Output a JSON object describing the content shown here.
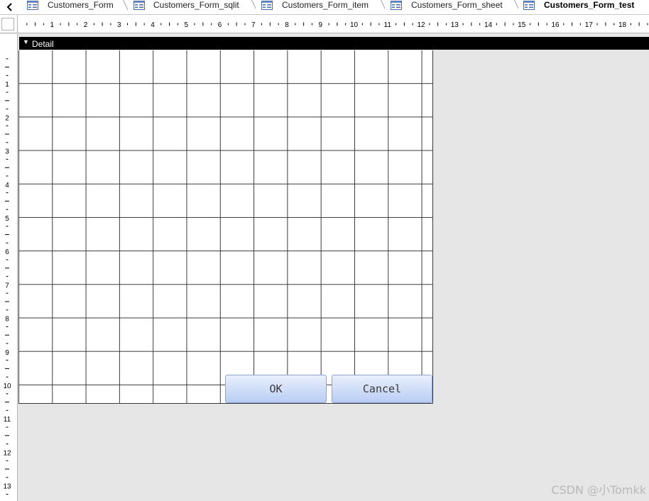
{
  "tabs": [
    {
      "label": "Customers_Form",
      "active": false
    },
    {
      "label": "Customers_Form_sqlit",
      "active": false
    },
    {
      "label": "Customers_Form_item",
      "active": false
    },
    {
      "label": "Customers_Form_sheet",
      "active": false
    },
    {
      "label": "Customers_Form_test",
      "active": true
    }
  ],
  "tab_scroll_icon": "chevron-left-icon",
  "horizontal_ruler": {
    "numbers": [
      "1",
      "2",
      "3",
      "4",
      "5",
      "6",
      "7",
      "8",
      "9",
      "10",
      "11",
      "12",
      "13",
      "14",
      "15",
      "16",
      "17",
      "18"
    ]
  },
  "vertical_ruler": {
    "numbers": [
      "1",
      "2",
      "3",
      "4",
      "5",
      "6",
      "7",
      "8",
      "9",
      "10",
      "11",
      "12",
      "13"
    ]
  },
  "section": {
    "label": "Detail",
    "icon": "section-collapse-arrow-icon"
  },
  "buttons": {
    "ok_label": "OK",
    "cancel_label": "Cancel"
  },
  "watermark": "CSDN @小Tomkk",
  "colors": {
    "canvas_background": "#e6e6e6",
    "section_bar": "#000000",
    "grid_line": "#3a3a3a",
    "button_gradient_top": "#e9f0fd",
    "button_gradient_bottom": "#b9cdf4"
  }
}
